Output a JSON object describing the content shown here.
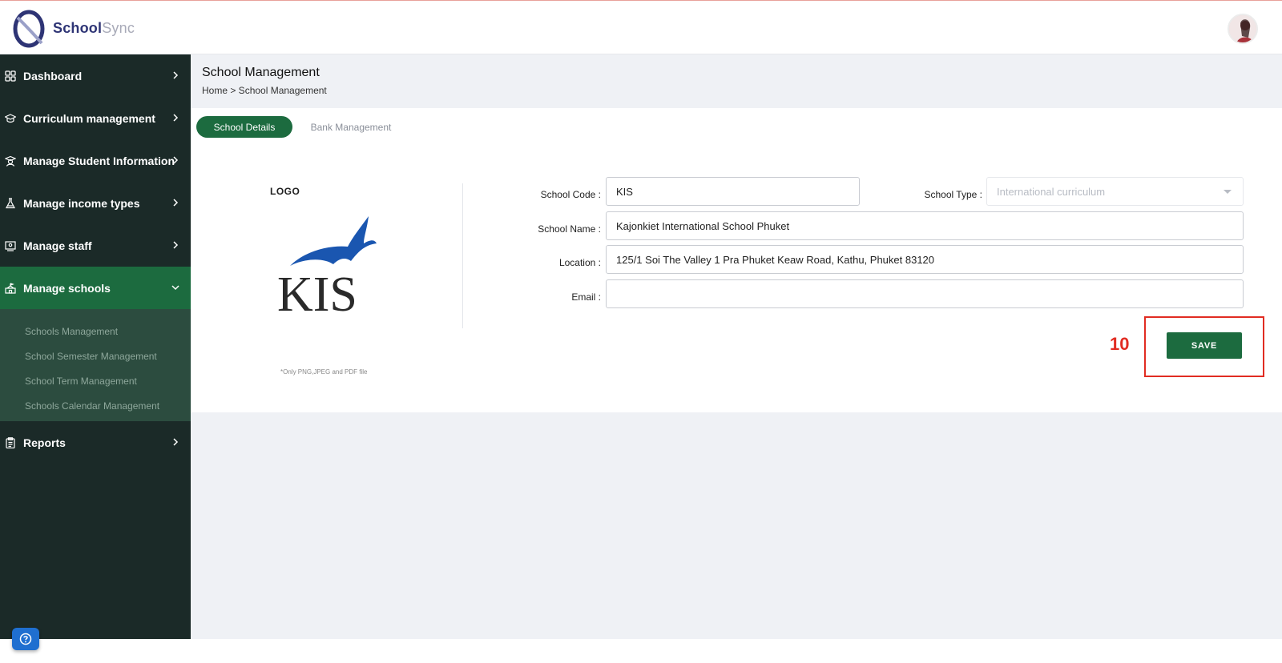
{
  "app": {
    "brand_primary": "School",
    "brand_secondary": "Sync",
    "accent_color": "#1c6b3f",
    "sidebar_color": "#1b2a28"
  },
  "sidebar": {
    "items": [
      {
        "label": "Dashboard",
        "icon": "grid-icon"
      },
      {
        "label": "Curriculum management",
        "icon": "graduation-cap-icon"
      },
      {
        "label": "Manage Student Information",
        "icon": "student-icon"
      },
      {
        "label": "Manage income types",
        "icon": "flask-icon"
      },
      {
        "label": "Manage staff",
        "icon": "staff-board-icon"
      },
      {
        "label": "Manage schools",
        "icon": "school-icon",
        "active": true
      },
      {
        "label": "Reports",
        "icon": "clipboard-icon"
      }
    ],
    "submenu": [
      "Schools Management",
      "School Semester Management",
      "School Term Management",
      "Schools Calendar Management"
    ]
  },
  "page": {
    "title": "School Management",
    "breadcrumb": "Home > School Management"
  },
  "tabs": {
    "active": "School Details",
    "inactive": "Bank Management"
  },
  "logo_panel": {
    "label": "LOGO",
    "logo_text": "KIS",
    "hint": "*Only PNG,JPEG and PDF file"
  },
  "form": {
    "school_code_label": "School Code :",
    "school_code_value": "KIS",
    "school_type_label": "School Type :",
    "school_type_value": "International curriculum",
    "school_name_label": "School Name :",
    "school_name_value": "Kajonkiet International School Phuket",
    "location_label": "Location :",
    "location_value": "125/1 Soi The Valley 1 Pra Phuket Keaw Road, Kathu, Phuket 83120",
    "email_label": "Email :",
    "email_value": ""
  },
  "actions": {
    "save_label": "SAVE"
  },
  "annotation": {
    "step_number": "10",
    "color": "#e12c22"
  }
}
